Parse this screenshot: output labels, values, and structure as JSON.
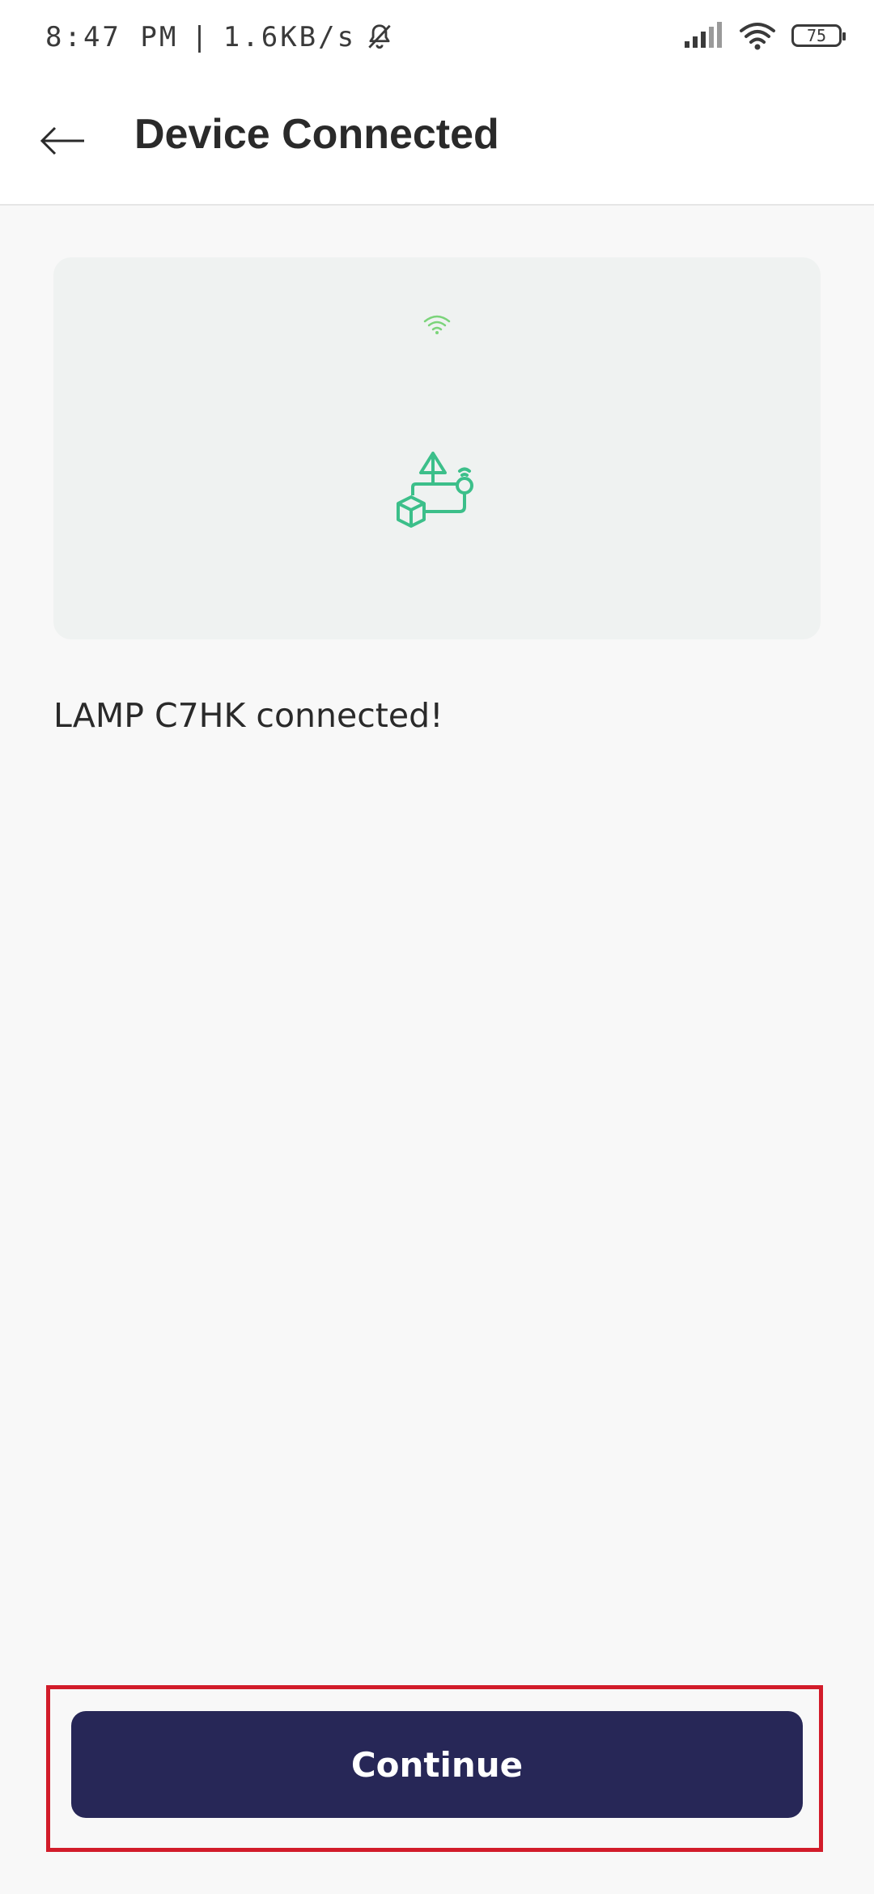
{
  "status_bar": {
    "time": "8:47 PM",
    "network_speed": "1.6KB/s",
    "battery_level": "75",
    "icons": [
      "mute-icon",
      "signal-icon",
      "wifi-icon",
      "battery-icon"
    ]
  },
  "header": {
    "title": "Device Connected",
    "back_icon": "arrow-left-icon"
  },
  "illustration": {
    "icons": [
      "wifi-icon",
      "device-network-icon"
    ],
    "accent_color": "#3cbf8a",
    "background_color": "#eff2f1"
  },
  "main": {
    "message": "LAMP C7HK connected!"
  },
  "footer": {
    "continue_label": "Continue",
    "button_color": "#272757",
    "highlight_color": "#d21c2a"
  }
}
